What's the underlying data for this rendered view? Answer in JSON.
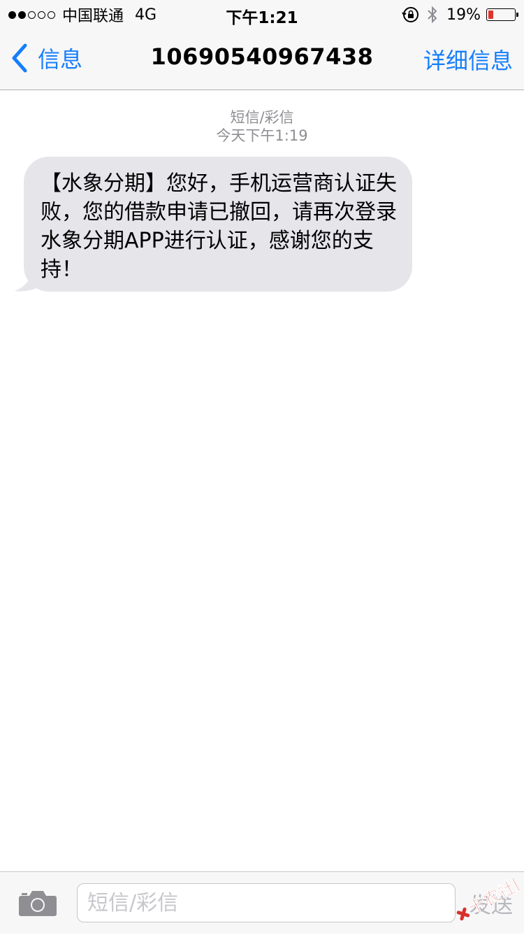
{
  "status_bar": {
    "carrier": "中国联通",
    "network": "4G",
    "time": "下午1:21",
    "battery_percent_label": "19%",
    "battery_level": 0.19,
    "signal_bars_filled": 2,
    "signal_bars_total": 5
  },
  "nav": {
    "back_label": "信息",
    "title": "10690540967438",
    "details_label": "详细信息"
  },
  "conversation": {
    "message_type": "短信/彩信",
    "timestamp": "今天下午1:19",
    "messages": [
      {
        "text": "【水象分期】您好，手机运营商认证失败，您的借款申请已撤回，请再次登录水象分期APP进行认证，感谢您的支持！"
      }
    ]
  },
  "input_bar": {
    "placeholder": "短信/彩信",
    "send_label": "发送"
  },
  "watermark": {
    "text": "卡农社区"
  },
  "colors": {
    "accent": "#157efb",
    "bubble_incoming": "#e5e5ea",
    "battery_low": "#e0352b",
    "meta_text": "#8e8e93"
  }
}
